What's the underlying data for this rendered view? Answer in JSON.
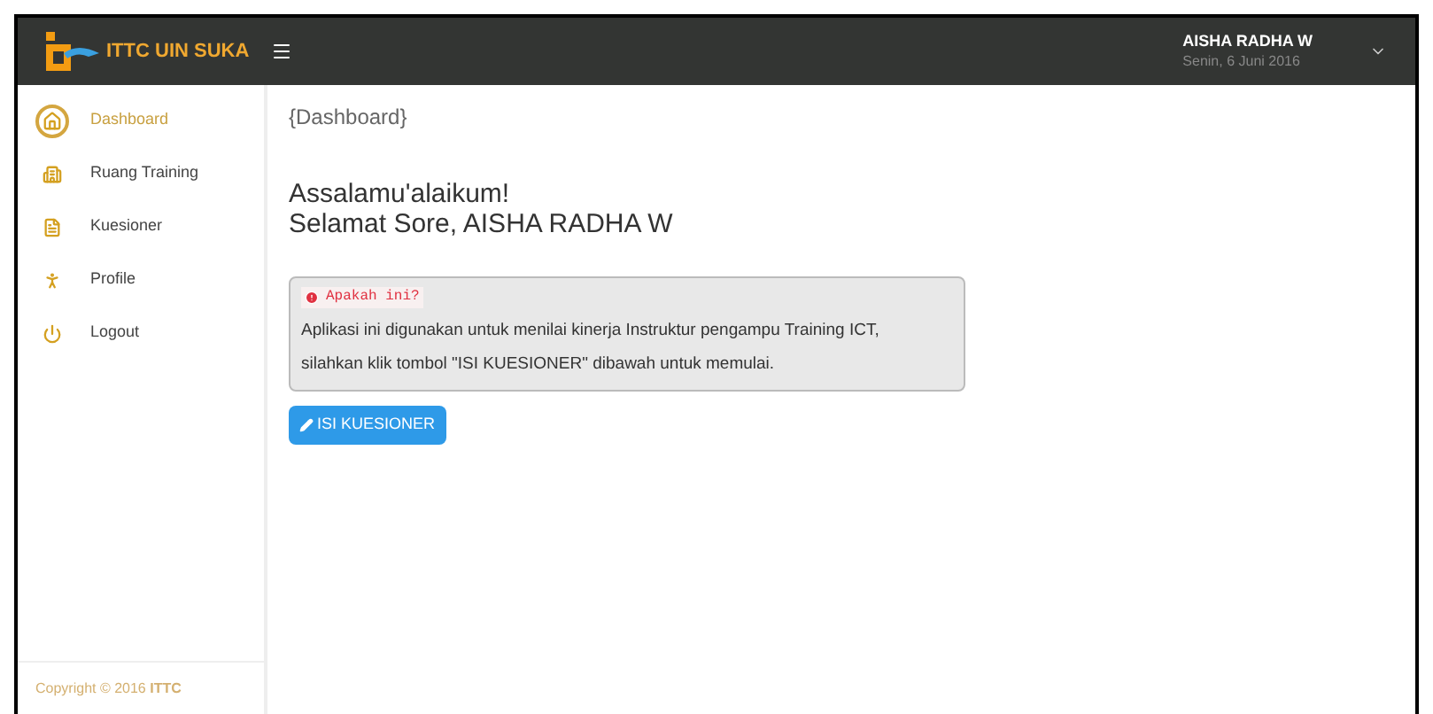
{
  "header": {
    "brand": "ITTC UIN SUKA",
    "user_name": "AISHA RADHA W",
    "date": "Senin, 6 Juni 2016"
  },
  "sidebar": {
    "items": [
      {
        "label": "Dashboard",
        "kind": "home",
        "selected": true
      },
      {
        "label": "Ruang Training",
        "kind": "room",
        "selected": false
      },
      {
        "label": "Kuesioner",
        "kind": "form",
        "selected": false
      },
      {
        "label": "Profile",
        "kind": "profile",
        "selected": false
      },
      {
        "label": "Logout",
        "kind": "logout",
        "selected": false
      }
    ],
    "footer": "Copyright © 2016 **ITTC**"
  },
  "content": {
    "breadcrumb": "{Dashboard}",
    "greeting": "Assalamu'alaikum!",
    "salutation": "Selamat Sore, AISHA RADHA W",
    "info": {
      "title": "Apakah ini?",
      "text": "Aplikasi ini digunakan untuk menilai kinerja Instruktur pengampu Training ICT, silahkan klik tombol \"ISI KUESIONER\" dibawah untuk memulai."
    },
    "button": "ISI KUESIONER"
  }
}
